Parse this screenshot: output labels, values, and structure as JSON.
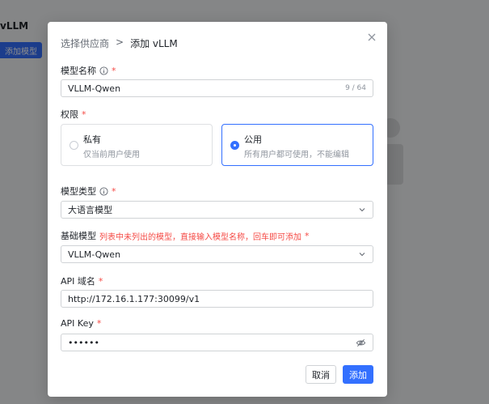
{
  "background": {
    "title": "vLLM",
    "add_model_button": "添加模型"
  },
  "dialog": {
    "breadcrumb": {
      "parent": "选择供应商",
      "separator": ">",
      "current": "添加 vLLM"
    },
    "model_name": {
      "label": "模型名称",
      "required": "*",
      "value": "VLLM-Qwen",
      "count": "9 / 64"
    },
    "permission": {
      "label": "权限",
      "required": "*",
      "options": [
        {
          "title": "私有",
          "desc": "仅当前用户使用",
          "selected": false
        },
        {
          "title": "公用",
          "desc": "所有用户都可使用，不能编辑",
          "selected": true
        }
      ]
    },
    "model_type": {
      "label": "模型类型",
      "required": "*",
      "value": "大语言模型"
    },
    "base_model": {
      "label": "基础模型",
      "hint": "列表中未列出的模型，直接输入模型名称，回车即可添加",
      "required": "*",
      "value": "VLLM-Qwen"
    },
    "api_domain": {
      "label": "API 域名",
      "required": "*",
      "value": "http://172.16.1.177:30099/v1"
    },
    "api_key": {
      "label": "API Key",
      "required": "*",
      "value": "••••••"
    },
    "buttons": {
      "cancel": "取消",
      "confirm": "添加"
    }
  },
  "colors": {
    "primary": "#3370ff",
    "required": "#f54a45",
    "overlay": "rgba(0,0,0,0.45)"
  },
  "icons": {
    "close": "close-icon",
    "info": "info-icon",
    "select": "chevron-down-icon",
    "password_toggle": "eye-off-icon"
  }
}
